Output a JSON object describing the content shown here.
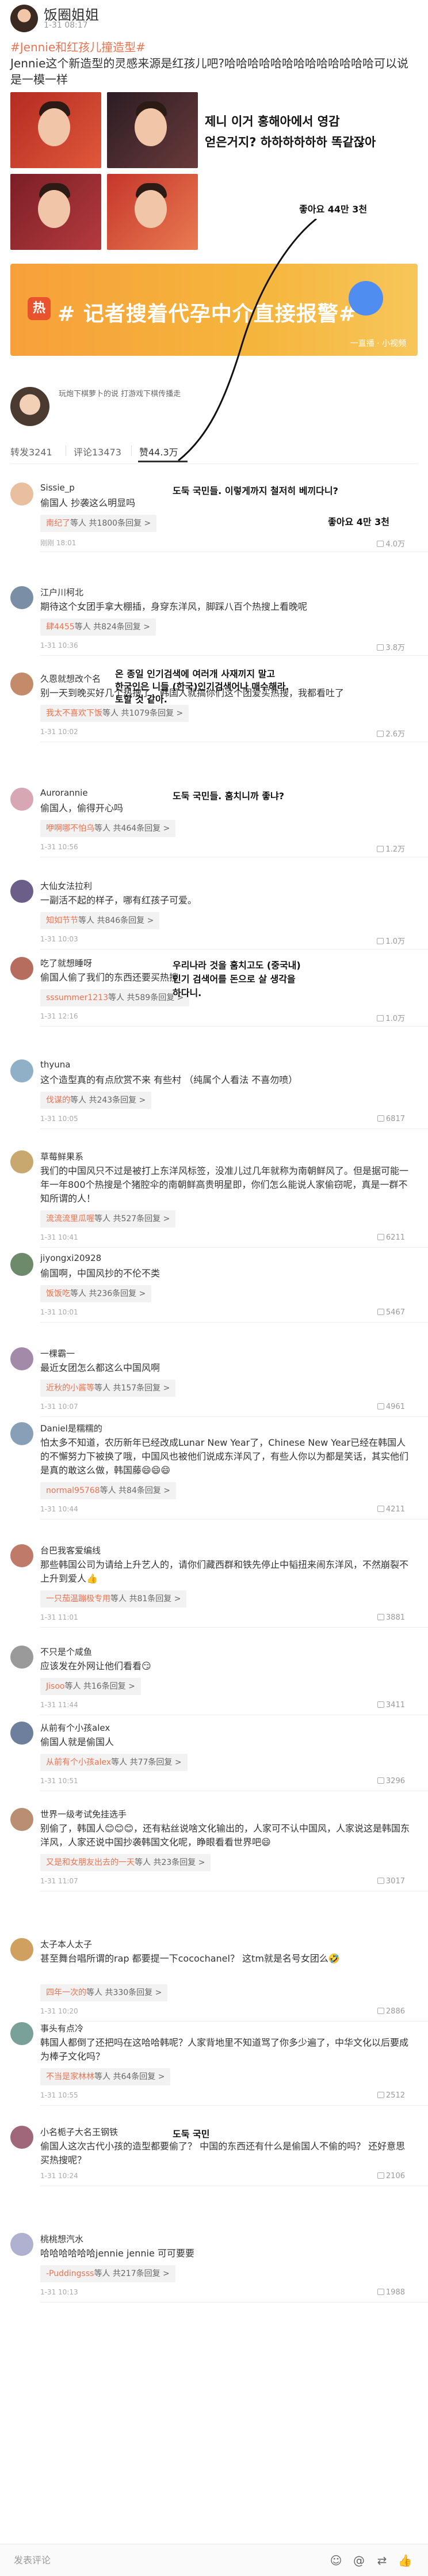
{
  "post": {
    "user": "饭圈姐姐",
    "time": "1-31 08:17",
    "body_hashtag": "#Jennie和红孩儿撞造型#",
    "body_text": "Jennie这个新造型的灵感来源是红孩儿吧?哈哈哈哈哈哈哈哈哈哈哈哈哈可以说是一模一样",
    "korean_caption_1": "제니 이거 홍해아에서 영감",
    "korean_caption_2": "얻은거지? 하하하하하하 똑같잖아",
    "likes_annotation": "좋아요 44만 3천"
  },
  "ad": {
    "icon": "热",
    "text": "# 记者搜着代孕中介直接报警#",
    "brand": "一直播 · 小视频"
  },
  "mini_card": {
    "text": "玩炮下棋萝卜的说 打游戏下棋传播走"
  },
  "tabs": {
    "repost": "转发3241",
    "comment": "评论13473",
    "like": "赞44.3万"
  },
  "comments": [
    {
      "name": "Sissie_p",
      "text": "偷国人 抄袭这么明显吗",
      "kor": "도둑 국민들. 이렇게까지 철저히 베끼다니?",
      "reply_name": "南纪了",
      "reply_text": "等人 共1800条回复 >",
      "time": "刚刚 18:01",
      "like": "4.0万",
      "kor_like": "좋아요 4만 3천"
    },
    {
      "name": "江户川柯北",
      "text": "期待这个女团手拿大棚插，身穿东洋风，脚踩八百个热搜上看晚呢",
      "reply_name": "肆4455",
      "reply_text": "等人 共824条回复 >",
      "time": "1-31 10:36",
      "like": "3.8万"
    },
    {
      "name": "久恩就想改个名",
      "text": "别一天到晚买好几个热搜了，韩国人就搞你们这个团爱买热搜，我都看吐了",
      "kor": "온 종일 인기검색에 여러개 사재끼지 말고",
      "kor2": "한국인은 니들 (한국)인기검색어나 매수해라.",
      "kor3": "토할 것 같아.",
      "reply_name": "我太不喜欢下饭",
      "reply_text": "等人 共1079条回复 >",
      "time": "1-31 10:02",
      "like": "2.6万"
    },
    {
      "name": "Aurorannie",
      "text": "偷国人，偷得开心吗",
      "kor": "도둑 국민들. 훔치니까 좋냐?",
      "reply_name": "咿啊哪不怕乌",
      "reply_text": "等人 共464条回复 >",
      "time": "1-31 10:56",
      "like": "1.2万"
    },
    {
      "name": "大仙女法拉利",
      "text": "一副活不起的样子，哪有红孩子可爱。",
      "reply_name": "知如节节",
      "reply_text": "等人 共846条回复 >",
      "time": "1-31 10:03",
      "like": "1.0万"
    },
    {
      "name": "吃了就想睡呀",
      "text": "偷国人偷了我们的东西还要买热搜",
      "kor": "우리나라 것을 훔치고도 (중국내)",
      "kor2": "인기 검색어를 돈으로 살 생각을",
      "kor3": "하다니.",
      "reply_name": "sssummer1213",
      "reply_text": "等人 共589条回复 >",
      "time": "1-31 12:16",
      "like": "1.0万"
    },
    {
      "name": "thyuna",
      "text": "这个造型真的有点欣赏不来 有些村 （纯属个人看法 不喜勿喷）",
      "reply_name": "伐谋的",
      "reply_text": "等人 共243条回复 >",
      "time": "1-31 10:05",
      "like": "6817"
    },
    {
      "name": "草莓鲜果系",
      "text": "我们的中国风只不过是被打上东洋风标签，没准儿过几年就称为南朝鲜风了。但是据可能一年一年800个热搜是个猪腔伞的南朝鲜高贵明星即，你们怎么能说人家偷窃呢，真是一群不知所谓的人！",
      "reply_name": "流流流里瓜喔",
      "reply_text": "等人 共527条回复 >",
      "time": "1-31 10:41",
      "like": "6211"
    },
    {
      "name": "jiyongxi20928",
      "text": "偷国啊，中国风抄的不伦不类",
      "reply_name": "饭饭吃",
      "reply_text": "等人 共236条回复 >",
      "time": "1-31 10:01",
      "like": "5467"
    },
    {
      "name": "一棵霸一",
      "text": "最近女团怎么都这么中国风啊",
      "reply_name": "近秋的小酱等",
      "reply_text": "等人 共157条回复 >",
      "time": "1-31 10:07",
      "like": "4961"
    },
    {
      "name": "Daniel是糯糯的",
      "text": "怕太多不知道，农历新年已经改成Lunar New Year了，Chinese New Year已经在韩国人的不懈努力下被换了哦，中国风也被他们说成东洋风了，有些人你以为都是笑话，其实他们是真的敢这么做，韩国藤😄😄😄",
      "reply_name": "normal95768",
      "reply_text": "等人 共84条回复 >",
      "time": "1-31 10:44",
      "like": "4211"
    },
    {
      "name": "台巴我客爱编线",
      "text": "那些韩国公司为请给上升艺人的，请你们藏西群和铁先停止中韬扭来闹东洋风，不然崩裂不上升到爱人👍",
      "reply_name": "一只茄温蹦极专用",
      "reply_text": "等人 共81条回复 >",
      "time": "1-31 11:01",
      "like": "3881"
    },
    {
      "name": "不只是个咸鱼",
      "text": "应该发在外网让他们看看😏",
      "reply_name": "Jisoo",
      "reply_text": "等人 共16条回复 >",
      "time": "1-31 11:44",
      "like": "3411"
    },
    {
      "name": "从前有个小孩alex",
      "text": "偷国人就是偷国人",
      "reply_name": "从前有个小孩alex",
      "reply_text": "等人 共77条回复 >",
      "time": "1-31 10:51",
      "like": "3296"
    },
    {
      "name": "世界一级考试免挂选手",
      "text": "别偷了，韩国人😊😊😊，还有粘丝说啥文化输出的，人家可不认中国风，人家说这是韩国东洋风，人家还说中国抄袭韩国文化呢，睁眼看看世界吧😄",
      "reply_name": "又是和女朋友出去的一天",
      "reply_text": "等人 共23条回复 >",
      "time": "1-31 11:07",
      "like": "3017"
    },
    {
      "name": "太子本人太子",
      "text": "甚至舞台唱所谓的rap 都要提一下cocochanel？ 这tm就是名号女团么🤣",
      "reply_name": "四年一次的",
      "reply_text": "等人 共330条回复 >",
      "time": "1-31 10:20",
      "like": "2886"
    },
    {
      "name": "事头有点冷",
      "text": "韩国人都倒了还把吗在这哈哈韩呢？人家背地里不知道骂了你多少遍了，中华文化以后要成为棒子文化吗？",
      "reply_name": "不当是家林林",
      "reply_text": "等人 共64条回复 >",
      "time": "1-31 10:55",
      "like": "2512"
    },
    {
      "name": "小名栀子大名王钢铁",
      "text": "偷国人这次古代小孩的造型都要偷了？ 中国的东西还有什么是偷国人不偷的吗？ 还好意思买热搜呢？",
      "kor": "도둑 국민",
      "reply_name": "",
      "reply_text": "",
      "time": "1-31 10:24",
      "like": "2106"
    },
    {
      "name": "桃桃想汽水",
      "text": "哈哈哈哈哈哈jennie jennie 可可要要",
      "reply_name": "-Puddingsss",
      "reply_text": "等人 共217条回复 >",
      "time": "1-31 10:13",
      "like": "1988"
    }
  ],
  "bottom_bar": {
    "placeholder": "发表评论",
    "icons": [
      "emoji-icon",
      "at-icon",
      "repost-icon",
      "like-icon"
    ]
  },
  "colors": {
    "hashtag": "#eb7350",
    "ad_bg": "#f5b53c",
    "reply_bg": "#f2f2f2"
  }
}
